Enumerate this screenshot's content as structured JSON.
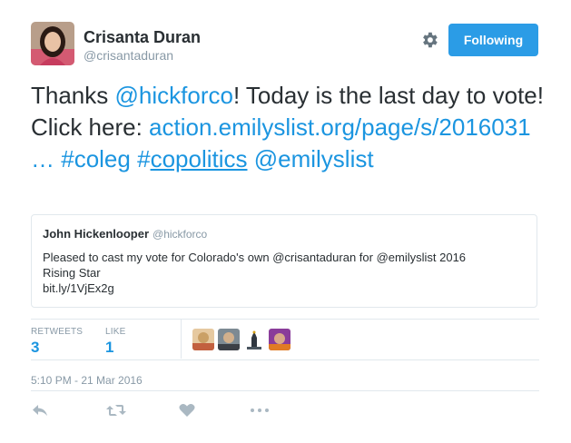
{
  "author": {
    "name": "Crisanta Duran",
    "handle": "@crisantaduran"
  },
  "follow_button": {
    "label": "Following",
    "color": "#2b9ce6"
  },
  "tweet": {
    "part1": "Thanks ",
    "mention1": "@hickforco",
    "part2": "! Today is the last day to vote! Click here: ",
    "link": "action.emilyslist.org/page/s/2016031 …",
    "space1": " ",
    "hashtag1": "#coleg",
    "space2": " ",
    "hashtag2_hash": "#",
    "hashtag2_text": "copolitics",
    "space3": " ",
    "mention2": "@emilyslist"
  },
  "quoted_tweet": {
    "name": "John Hickenlooper",
    "handle": "@hickforco",
    "line1": "Pleased to cast my vote for Colorado's own @crisantaduran for @emilyslist 2016",
    "line2": "Rising Star",
    "line3": "bit.ly/1VjEx2g"
  },
  "stats": {
    "retweets_label": "RETWEETS",
    "retweets_value": "3",
    "likes_label": "LIKE",
    "likes_value": "1"
  },
  "timestamp": "5:10 PM - 21 Mar 2016",
  "colors": {
    "link": "#1b95e0",
    "muted": "#8899a6",
    "border": "#e1e8ed"
  },
  "icons": [
    "settings-gear-icon",
    "reply-icon",
    "retweet-icon",
    "like-heart-icon",
    "more-dots-icon"
  ]
}
